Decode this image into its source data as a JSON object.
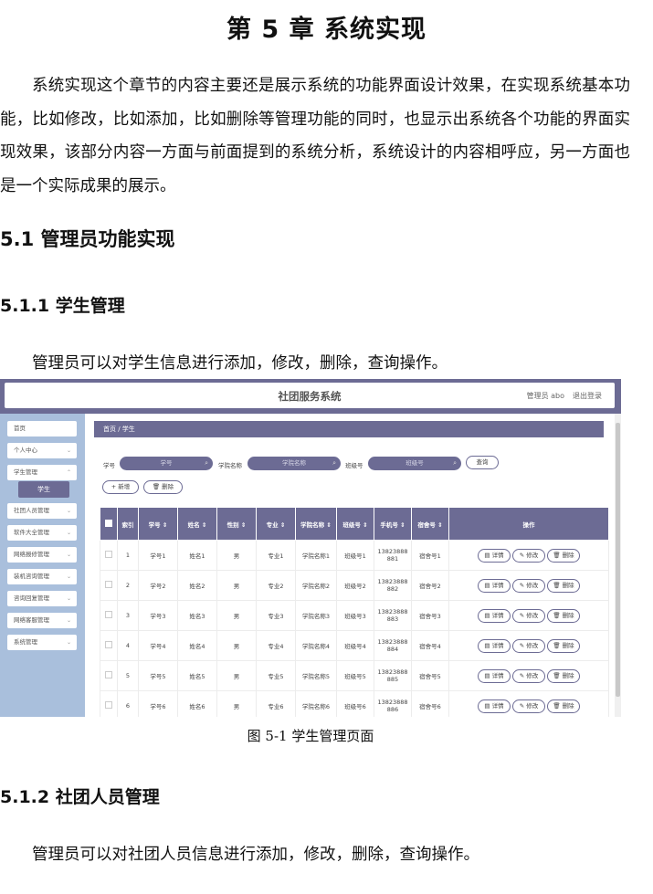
{
  "chapter_title": "第 5 章  系统实现",
  "intro_paragraph": "系统实现这个章节的内容主要还是展示系统的功能界面设计效果，在实现系统基本功能，比如修改，比如添加，比如删除等管理功能的同时，也显示出系统各个功能的界面实现效果，该部分内容一方面与前面提到的系统分析，系统设计的内容相呼应，另一方面也是一个实际成果的展示。",
  "section_5_1": "5.1 管理员功能实现",
  "section_5_1_1": "5.1.1  学生管理",
  "text_5_1_1": "管理员可以对学生信息进行添加，修改，删除，查询操作。",
  "figure_caption": "图 5-1 学生管理页面",
  "section_5_1_2": "5.1.2  社团人员管理",
  "text_5_1_2": "管理员可以对社团人员信息进行添加，修改，删除，查询操作。",
  "screenshot": {
    "app_title": "社团服务系统",
    "admin_label": "管理员 abo",
    "logout_label": "退出登录",
    "menu": [
      "首页",
      "个人中心",
      "学生管理",
      "社团人员管理",
      "软件大全管理",
      "网络报修管理",
      "装机咨询管理",
      "咨询回复管理",
      "网络客服管理",
      "系统管理"
    ],
    "submenu_active": "学生",
    "breadcrumb": "首页  /  学生",
    "filters": {
      "student_no_label": "学号",
      "student_no_placeholder": "学号",
      "college_label": "学院名称",
      "college_placeholder": "学院名称",
      "class_label": "班级号",
      "class_placeholder": "班级号",
      "search_button": "查询"
    },
    "add_button": "+ 新增",
    "delete_button": "删除",
    "columns": [
      "索引",
      "学号 ⇕",
      "姓名 ⇕",
      "性别 ⇕",
      "专业 ⇕",
      "学院名称 ⇕",
      "班级号 ⇕",
      "手机号 ⇕",
      "宿舍号 ⇕",
      "操作"
    ],
    "rows": [
      [
        "1",
        "学号1",
        "姓名1",
        "男",
        "专业1",
        "学院名称1",
        "班级号1",
        "13823888881",
        "宿舍号1"
      ],
      [
        "2",
        "学号2",
        "姓名2",
        "男",
        "专业2",
        "学院名称2",
        "班级号2",
        "13823888882",
        "宿舍号2"
      ],
      [
        "3",
        "学号3",
        "姓名3",
        "男",
        "专业3",
        "学院名称3",
        "班级号3",
        "13823888883",
        "宿舍号3"
      ],
      [
        "4",
        "学号4",
        "姓名4",
        "男",
        "专业4",
        "学院名称4",
        "班级号4",
        "13823888884",
        "宿舍号4"
      ],
      [
        "5",
        "学号5",
        "姓名5",
        "男",
        "专业5",
        "学院名称5",
        "班级号5",
        "13823888885",
        "宿舍号5"
      ],
      [
        "6",
        "学号6",
        "姓名6",
        "男",
        "专业6",
        "学院名称6",
        "班级号6",
        "13823888886",
        "宿舍号6"
      ]
    ],
    "row_actions": {
      "detail": "详情",
      "edit": "修改",
      "delete": "删除"
    },
    "icons": {
      "search": "search-icon",
      "detail": "document-icon",
      "edit": "pencil-icon",
      "delete": "trash-icon",
      "chevron": "chevron-down-icon"
    },
    "colors": {
      "accent": "#6c6b94",
      "sidebar_bg": "#a9bfdc"
    }
  }
}
